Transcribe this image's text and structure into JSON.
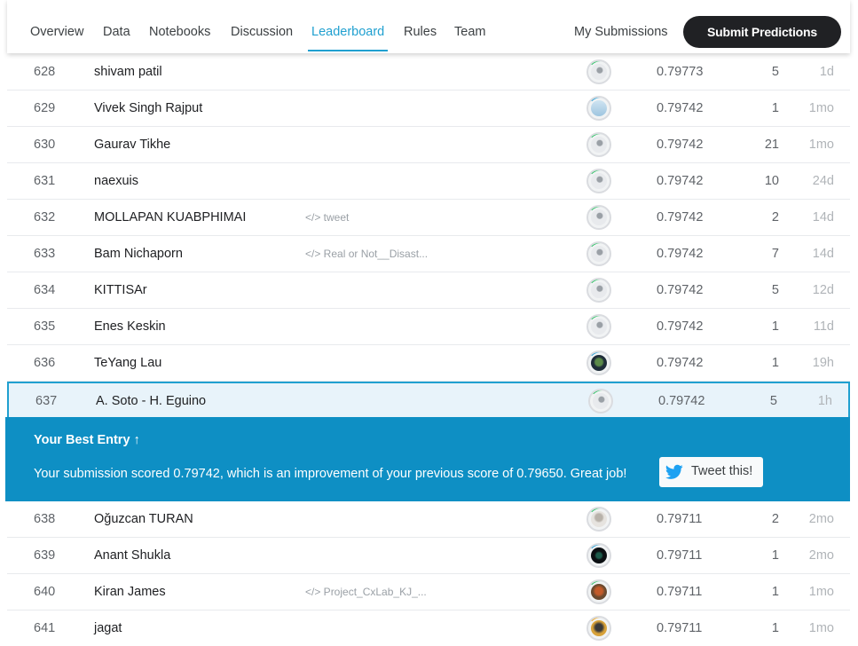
{
  "nav": {
    "tabs": [
      {
        "label": "Overview",
        "active": false
      },
      {
        "label": "Data",
        "active": false
      },
      {
        "label": "Notebooks",
        "active": false
      },
      {
        "label": "Discussion",
        "active": false
      },
      {
        "label": "Leaderboard",
        "active": true
      },
      {
        "label": "Rules",
        "active": false
      },
      {
        "label": "Team",
        "active": false
      }
    ],
    "my_submissions": "My Submissions",
    "submit_label": "Submit Predictions"
  },
  "rows_above": [
    {
      "rank": "628",
      "team": "shivam patil",
      "kernel": "",
      "score": "0.79773",
      "entries": "5",
      "last": "1d",
      "avatar": "default"
    },
    {
      "rank": "629",
      "team": "Vivek Singh Rajput",
      "kernel": "",
      "score": "0.79742",
      "entries": "1",
      "last": "1mo",
      "avatar": "photo-blue"
    },
    {
      "rank": "630",
      "team": "Gaurav Tikhe",
      "kernel": "",
      "score": "0.79742",
      "entries": "21",
      "last": "1mo",
      "avatar": "default"
    },
    {
      "rank": "631",
      "team": "naexuis",
      "kernel": "",
      "score": "0.79742",
      "entries": "10",
      "last": "24d",
      "avatar": "default"
    },
    {
      "rank": "632",
      "team": "MOLLAPAN KUABPHIMAI",
      "kernel": "tweet",
      "score": "0.79742",
      "entries": "2",
      "last": "14d",
      "avatar": "default"
    },
    {
      "rank": "633",
      "team": "Bam Nichaporn",
      "kernel": "Real or Not__Disast...",
      "score": "0.79742",
      "entries": "7",
      "last": "14d",
      "avatar": "default"
    },
    {
      "rank": "634",
      "team": "KITTISAr",
      "kernel": "",
      "score": "0.79742",
      "entries": "5",
      "last": "12d",
      "avatar": "default"
    },
    {
      "rank": "635",
      "team": "Enes Keskin",
      "kernel": "",
      "score": "0.79742",
      "entries": "1",
      "last": "11d",
      "avatar": "default"
    },
    {
      "rank": "636",
      "team": "TeYang Lau",
      "kernel": "",
      "score": "0.79742",
      "entries": "1",
      "last": "19h",
      "avatar": "photo-dark-blue"
    },
    {
      "rank": "637",
      "team": "A. Soto - H. Eguino",
      "kernel": "",
      "score": "0.79742",
      "entries": "5",
      "last": "1h",
      "avatar": "default"
    }
  ],
  "banner": {
    "title": "Your Best Entry ↑",
    "message": "Your submission scored 0.79742, which is an improvement of your previous score of 0.79650. Great job!",
    "tweet_label": "Tweet this!"
  },
  "rows_below": [
    {
      "rank": "638",
      "team": "Oğuzcan TURAN",
      "kernel": "",
      "score": "0.79711",
      "entries": "2",
      "last": "2mo",
      "avatar": "photo-light"
    },
    {
      "rank": "639",
      "team": "Anant Shukla",
      "kernel": "",
      "score": "0.79711",
      "entries": "1",
      "last": "2mo",
      "avatar": "photo-black"
    },
    {
      "rank": "640",
      "team": "Kiran James",
      "kernel": "Project_CxLab_KJ_...",
      "score": "0.79711",
      "entries": "1",
      "last": "1mo",
      "avatar": "photo-orange"
    },
    {
      "rank": "641",
      "team": "jagat",
      "kernel": "",
      "score": "0.79711",
      "entries": "1",
      "last": "1mo",
      "avatar": "photo-amber"
    }
  ],
  "colors": {
    "accent": "#20a0d0",
    "banner": "#0e8fc4",
    "submit": "#202124",
    "progress": "#20c05c"
  }
}
